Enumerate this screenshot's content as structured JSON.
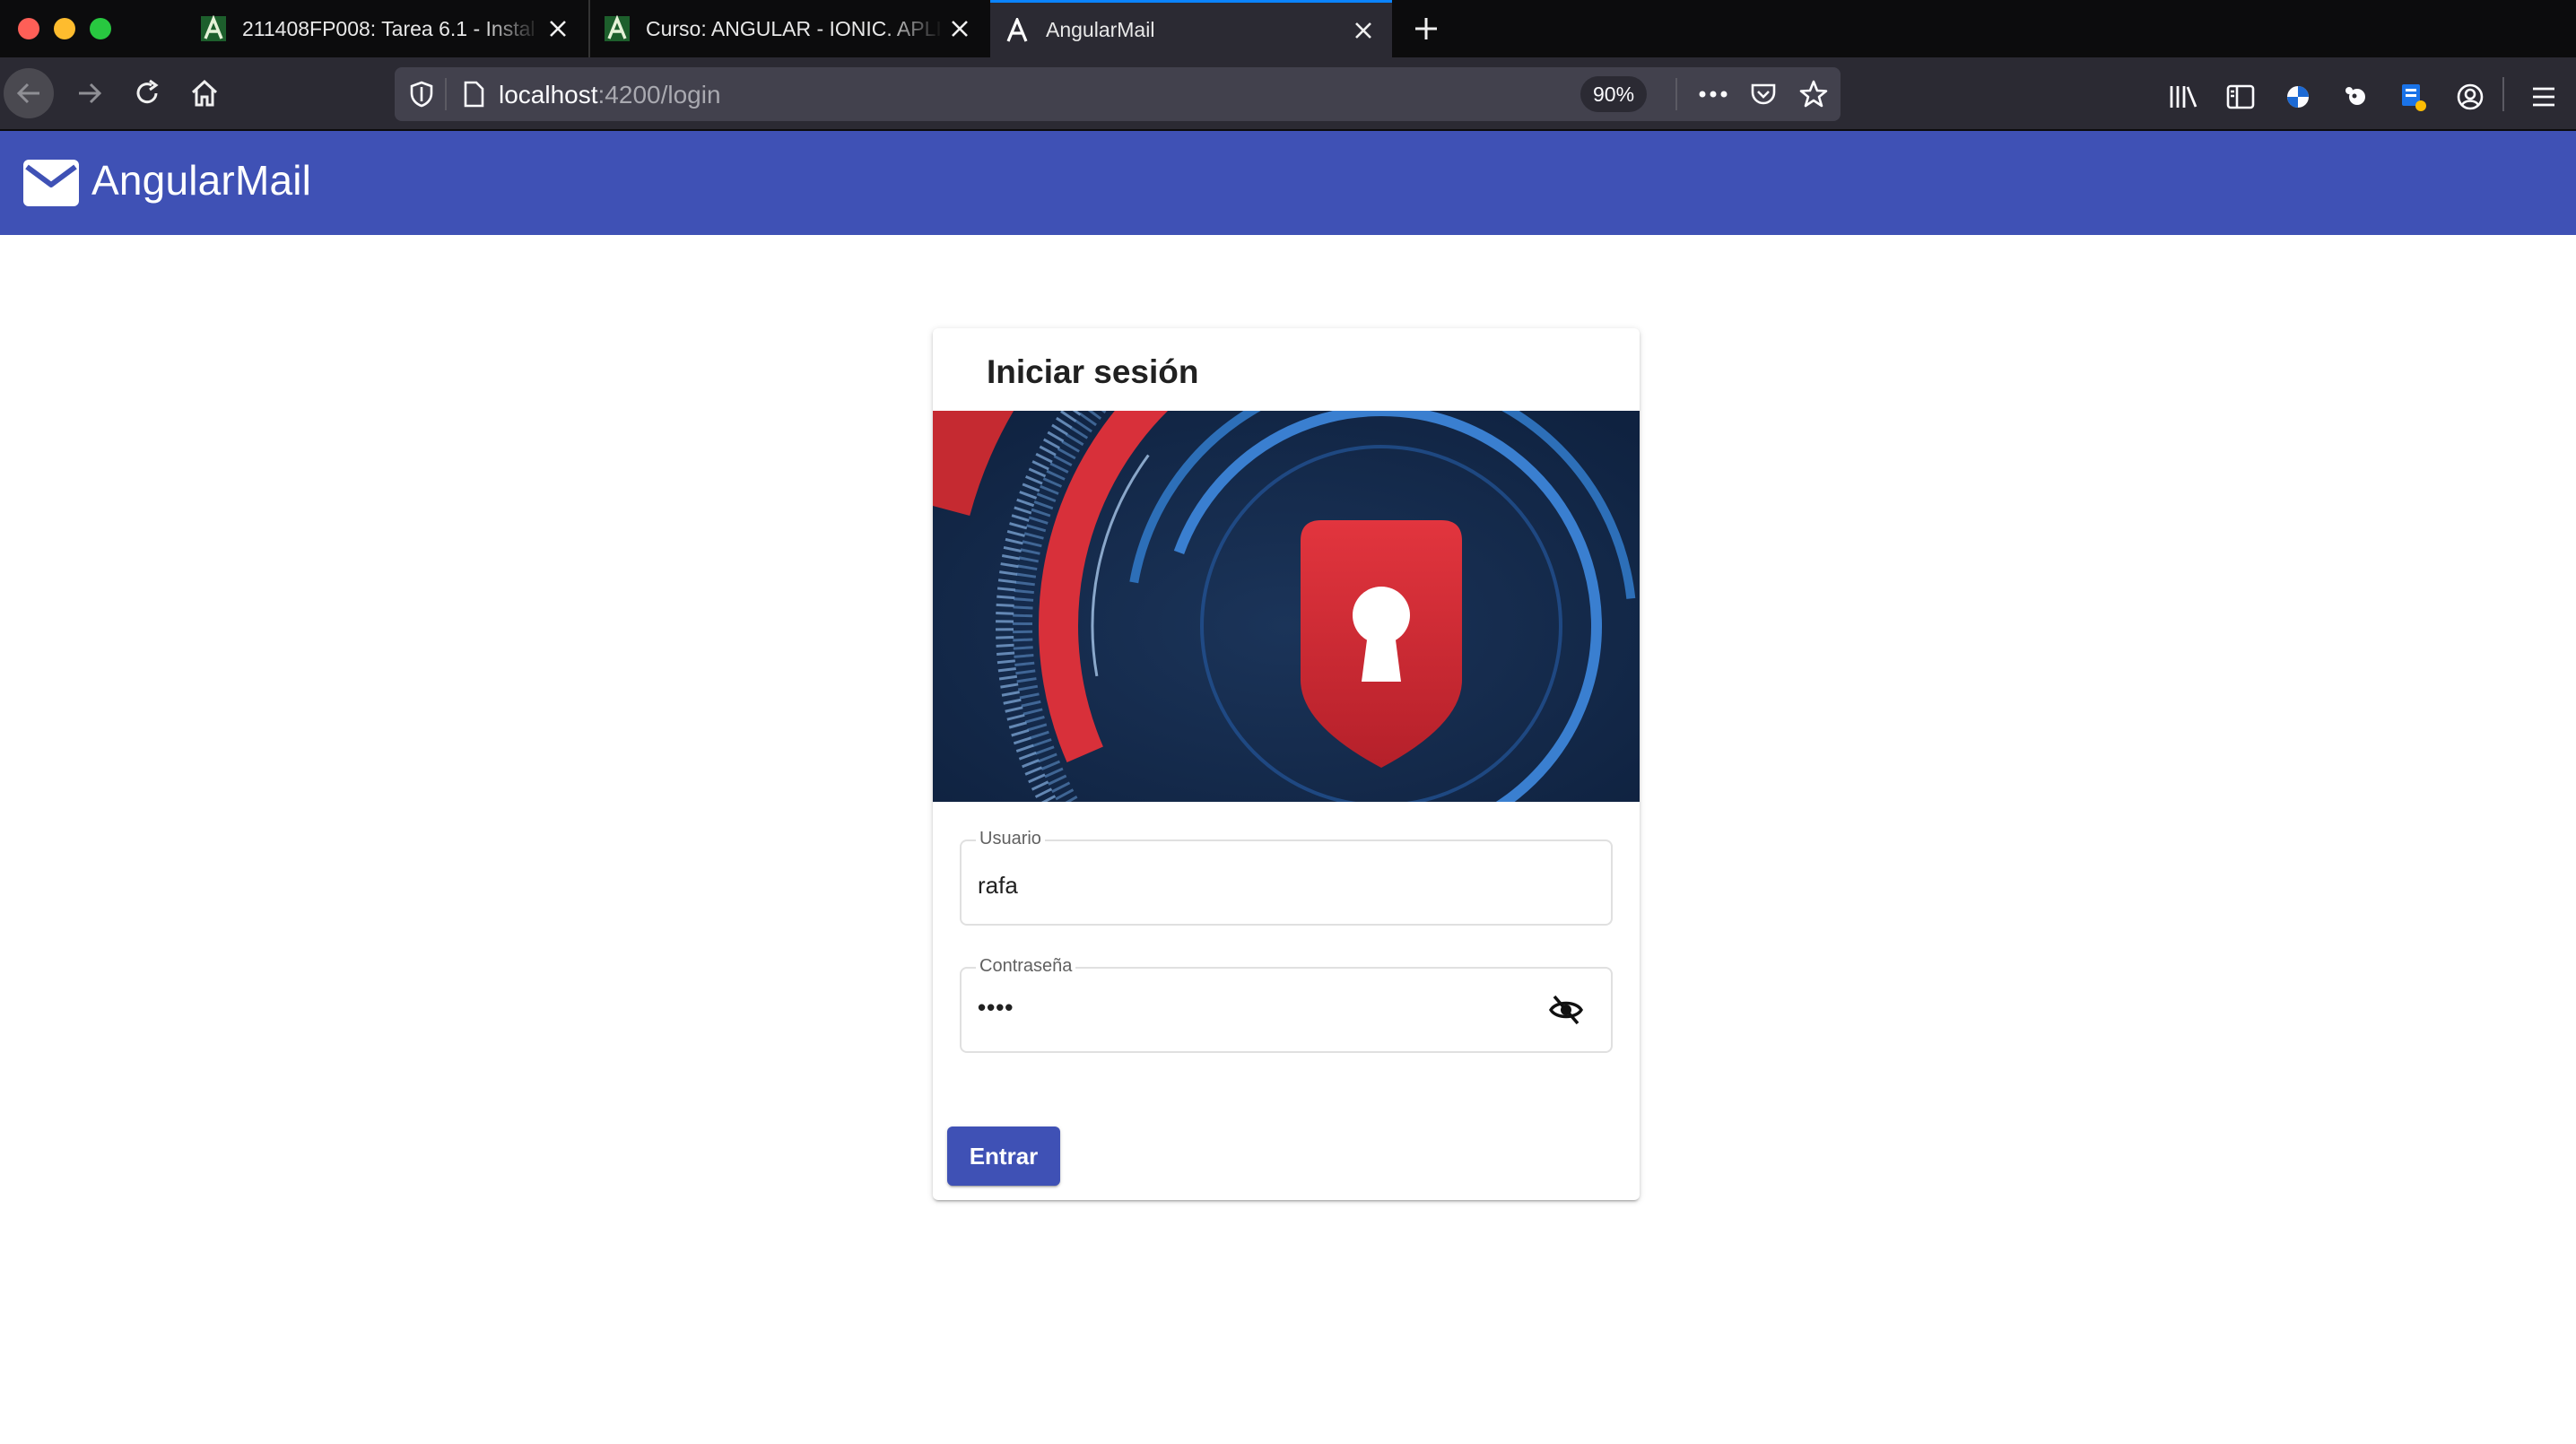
{
  "browser": {
    "tabs": [
      {
        "title": "211408FP008: Tarea 6.1 - Instal",
        "favicon": "moodle-a-icon",
        "active": false
      },
      {
        "title": "Curso: ANGULAR - IONIC. APLI",
        "favicon": "moodle-a-icon",
        "active": false
      },
      {
        "title": "AngularMail",
        "favicon": "angular-icon",
        "active": true
      }
    ],
    "url_host": "localhost",
    "url_path": ":4200/login",
    "zoom": "90%"
  },
  "app": {
    "title": "AngularMail",
    "brand_color": "#3f51b5"
  },
  "login": {
    "title": "Iniciar sesión",
    "username_label": "Usuario",
    "username_value": "rafa",
    "password_label": "Contraseña",
    "password_value": "••••",
    "submit_label": "Entrar"
  }
}
